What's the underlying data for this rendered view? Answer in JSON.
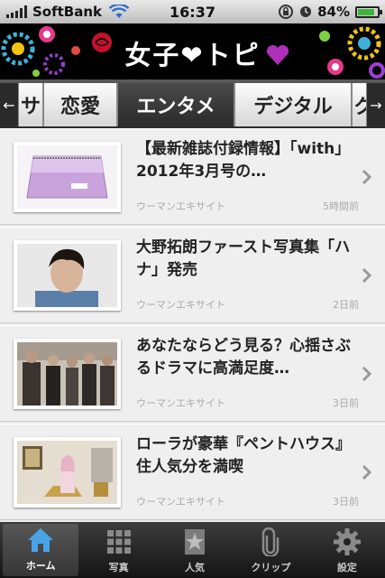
{
  "status": {
    "carrier": "SoftBank",
    "time": "16:37",
    "battery_text": "84%",
    "battery_level": 0.84
  },
  "header": {
    "title": "女子❤トピ"
  },
  "tabs": {
    "items": [
      {
        "label": "サ"
      },
      {
        "label": "恋愛"
      },
      {
        "label": "エンタメ"
      },
      {
        "label": "デジタル"
      },
      {
        "label": "グ"
      }
    ],
    "active_index": 2,
    "left_arrow": "←",
    "right_arrow": "→"
  },
  "articles": [
    {
      "title": "【最新雑誌付録情報】「with」2012年3月号の…",
      "source": "ウーマンエキサイト",
      "time": "5時間前",
      "thumb": "pink-pouch"
    },
    {
      "title": "大野拓朗ファースト写真集「ハナ」発売",
      "source": "ウーマンエキサイト",
      "time": "2日前",
      "thumb": "portrait"
    },
    {
      "title": "あなたならどう見る？心揺さぶるドラマに高満足度…",
      "source": "ウーマンエキサイト",
      "time": "3日前",
      "thumb": "drama-group"
    },
    {
      "title": "ローラが豪華『ペントハウス』住人気分を満喫",
      "source": "ウーマンエキサイト",
      "time": "3日前",
      "thumb": "penthouse"
    }
  ],
  "tabbar": {
    "items": [
      {
        "label": "ホーム",
        "icon": "home-icon"
      },
      {
        "label": "写真",
        "icon": "grid-icon"
      },
      {
        "label": "人気",
        "icon": "star-icon"
      },
      {
        "label": "クリップ",
        "icon": "paperclip-icon"
      },
      {
        "label": "設定",
        "icon": "gear-icon"
      }
    ],
    "active_index": 0
  },
  "colors": {
    "header_bg": "#000000",
    "active_tab": "#2a2a2a",
    "battery_green": "#3bb53b",
    "heart": "#e91e8c"
  }
}
